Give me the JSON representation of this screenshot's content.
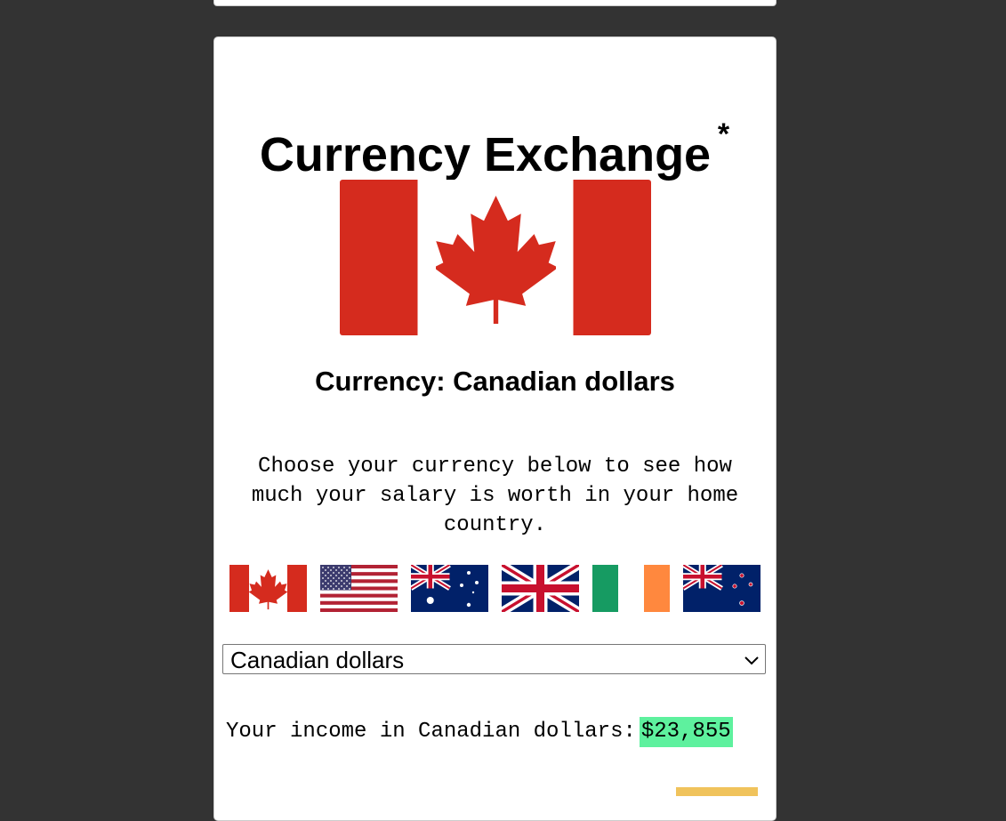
{
  "page": {
    "title": "Currency Exchange",
    "title_mark": "*"
  },
  "selected": {
    "flag_icon": "canada-flag-icon",
    "currency_label": "Currency: Canadian dollars"
  },
  "instructions": "Choose your currency below to see how much your salary is worth in your home country.",
  "flags": [
    {
      "name": "canada",
      "icon": "canada-flag-icon"
    },
    {
      "name": "united-states",
      "icon": "usa-flag-icon"
    },
    {
      "name": "australia",
      "icon": "australia-flag-icon"
    },
    {
      "name": "united-kingdom",
      "icon": "uk-flag-icon"
    },
    {
      "name": "ireland",
      "icon": "ireland-flag-icon"
    },
    {
      "name": "new-zealand",
      "icon": "new-zealand-flag-icon"
    }
  ],
  "currency_select": {
    "value": "Canadian dollars"
  },
  "income": {
    "label": "Your income in Canadian dollars:",
    "value": "$23,855"
  },
  "colors": {
    "background": "#333333",
    "card": "#ffffff",
    "canada_red": "#d52b1e",
    "income_highlight": "#5ef19e",
    "next_highlight": "#f0c35c"
  }
}
